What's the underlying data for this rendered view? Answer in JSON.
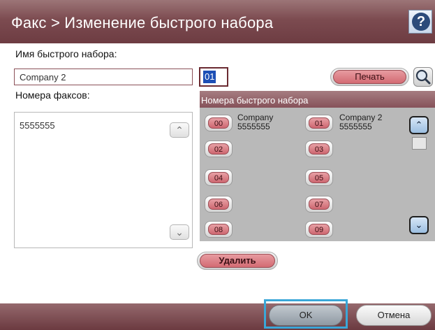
{
  "header": {
    "title": "Факс > Изменение быстрого набора",
    "help_icon": "help-question-icon"
  },
  "form": {
    "name_label": "Имя быстрого набора:",
    "name_value": "Company 2",
    "number_value": "01",
    "fax_numbers_label": "Номера факсов:",
    "fax_numbers": [
      "5555555"
    ],
    "print_button": "Печать",
    "search_icon": "magnifier-icon"
  },
  "speed_dial": {
    "header": "Номера быстрого набора",
    "entries": [
      {
        "code": "00",
        "name": "Company",
        "number": "5555555"
      },
      {
        "code": "01",
        "name": "Company 2",
        "number": "5555555"
      },
      {
        "code": "02",
        "name": "",
        "number": ""
      },
      {
        "code": "03",
        "name": "",
        "number": ""
      },
      {
        "code": "04",
        "name": "",
        "number": ""
      },
      {
        "code": "05",
        "name": "",
        "number": ""
      },
      {
        "code": "06",
        "name": "",
        "number": ""
      },
      {
        "code": "07",
        "name": "",
        "number": ""
      },
      {
        "code": "08",
        "name": "",
        "number": ""
      },
      {
        "code": "09",
        "name": "",
        "number": ""
      }
    ]
  },
  "actions": {
    "delete_button": "Удалить"
  },
  "footer": {
    "ok_button": "OK",
    "cancel_button": "Отмена"
  },
  "colors": {
    "accent": "#7c4b50",
    "slot_badge": "#d36b73",
    "focus": "#3aa7d8"
  }
}
